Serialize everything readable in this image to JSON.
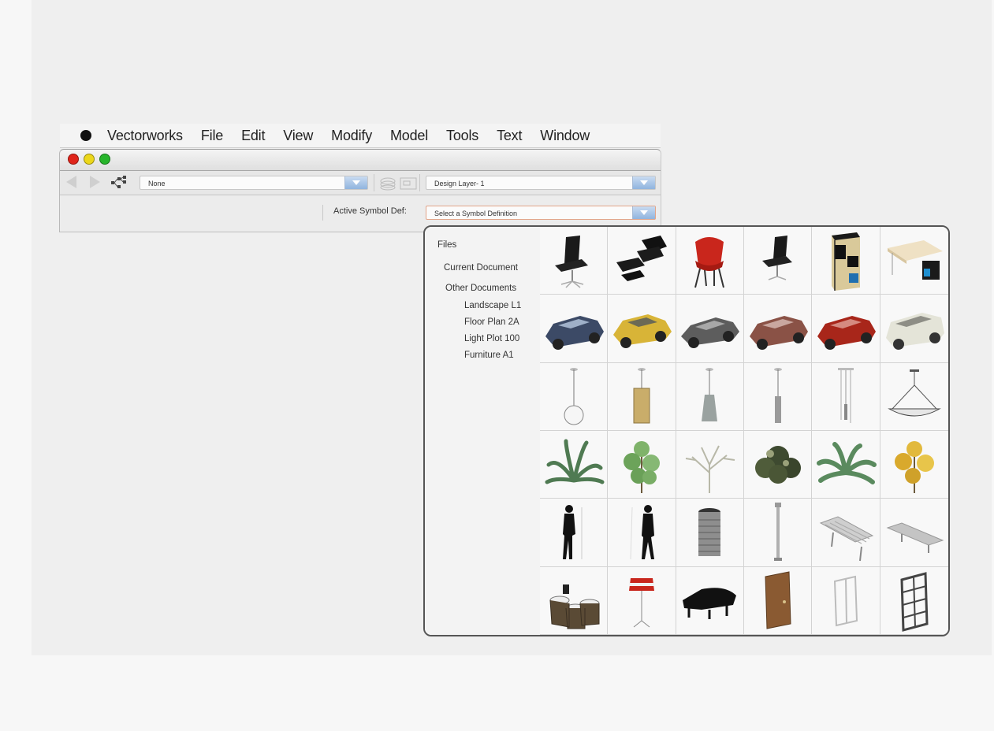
{
  "menubar": {
    "apple_icon": "apple-logo-icon",
    "items": [
      "Vectorworks",
      "File",
      "Edit",
      "View",
      "Modify",
      "Model",
      "Tools",
      "Text",
      "Window"
    ]
  },
  "toolbar": {
    "class_value": "None",
    "layer_value": "Design Layer- 1"
  },
  "symbol_bar": {
    "label": "Active Symbol Def:",
    "select_placeholder": "Select a Symbol Definition"
  },
  "picker": {
    "files_title": "Files",
    "current_document": "Current Document",
    "other_documents": "Other Documents",
    "documents": [
      "Landscape L1",
      "Floor Plan 2A",
      "Light Plot 100",
      "Furniture A1"
    ],
    "symbols": [
      "office-chair-black",
      "lounge-chair-ottoman",
      "red-shell-chair",
      "office-chair-small",
      "bookshelf-unit",
      "desk-with-cabinet",
      "car-blue-suv",
      "car-yellow-compact",
      "car-gray-sedan",
      "car-red-suv",
      "car-red-crossover",
      "van-white",
      "pendant-globe-lamp",
      "pendant-box-lamp",
      "pendant-bell-lamp",
      "pendant-cylinder-lamp",
      "pendant-multi-lamp",
      "pendant-dish-lamp",
      "plant-agave",
      "tree-leafy",
      "tree-bare",
      "shrub-dark",
      "plant-palm",
      "tree-yellow",
      "person-woman",
      "person-man",
      "trash-bin",
      "street-lamp",
      "bench-slatted",
      "bench-flat",
      "cafe-table-set",
      "red-shade-floor-lamp",
      "grand-piano",
      "door-wood",
      "window-double",
      "window-grid"
    ]
  }
}
